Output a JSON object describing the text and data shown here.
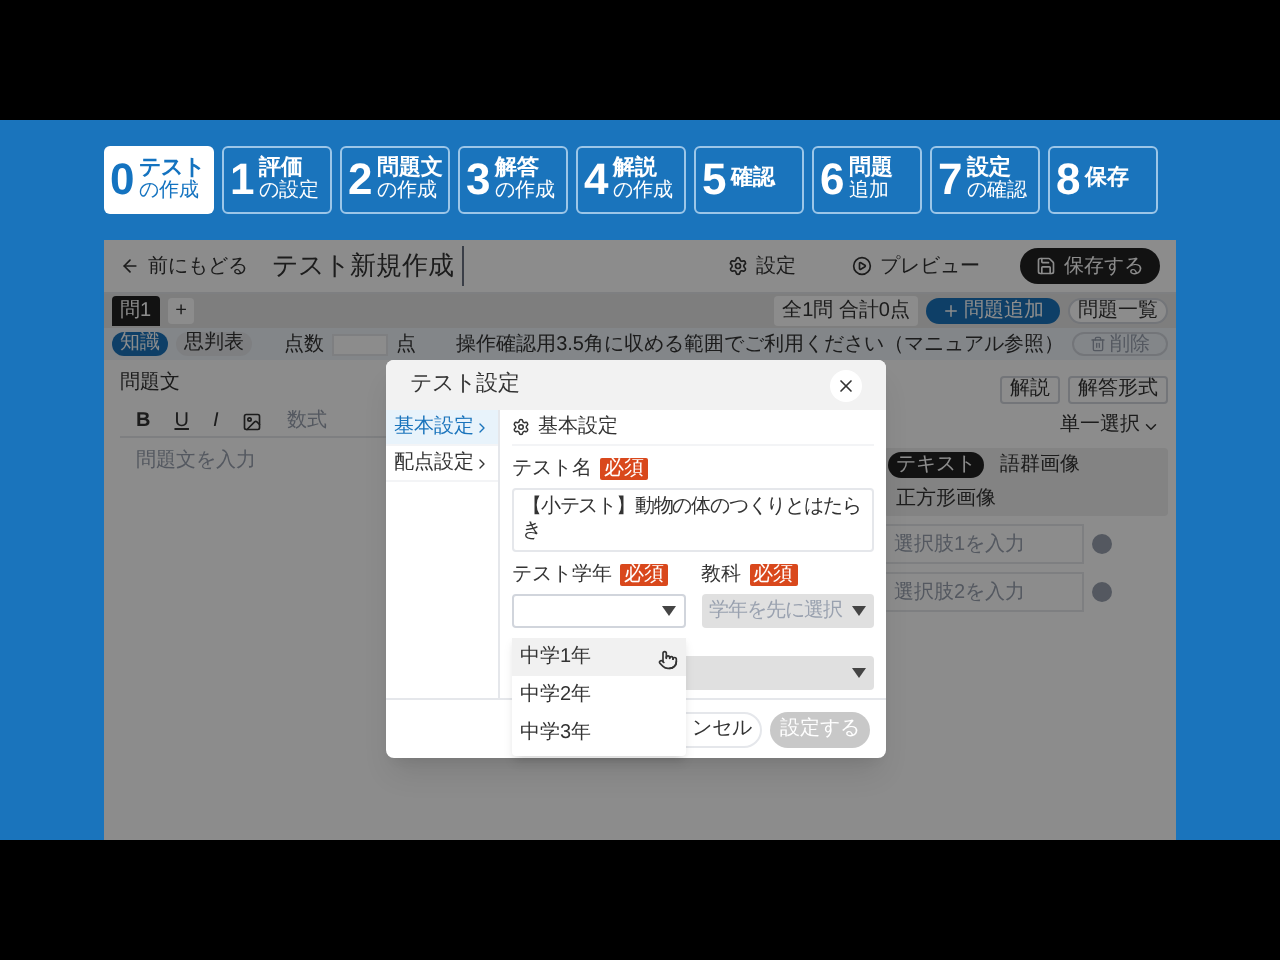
{
  "steps": [
    {
      "number": "0",
      "lines": [
        "テスト",
        "の作成"
      ],
      "selected": true
    },
    {
      "number": "1",
      "lines": [
        "評価",
        "の設定"
      ],
      "selected": false
    },
    {
      "number": "2",
      "lines": [
        "問題文",
        "の作成"
      ],
      "selected": false
    },
    {
      "number": "3",
      "lines": [
        "解答",
        "の作成"
      ],
      "selected": false
    },
    {
      "number": "4",
      "lines": [
        "解説",
        "の作成"
      ],
      "selected": false
    },
    {
      "number": "5",
      "lines": [
        "確認"
      ],
      "selected": false
    },
    {
      "number": "6",
      "lines": [
        "問題",
        "追加"
      ],
      "selected": false
    },
    {
      "number": "7",
      "lines": [
        "設定",
        "の確認"
      ],
      "selected": false
    },
    {
      "number": "8",
      "lines": [
        "保存"
      ],
      "selected": false
    }
  ],
  "app": {
    "back": "前にもどる",
    "title": "テスト新規作成",
    "actions": [
      {
        "kind": "settings",
        "label": "設定"
      },
      {
        "kind": "preview",
        "label": "プレビュー"
      },
      {
        "kind": "save",
        "label": "保存する"
      }
    ],
    "question_tabs": [
      {
        "label": "問1",
        "selected": true
      }
    ],
    "add_tab": "+",
    "summary": "全1問 合計0点",
    "add_question": "問題追加",
    "question_list": "問題一覧",
    "categories": [
      {
        "label": "知識",
        "selected": true
      },
      {
        "label": "思判表",
        "selected": false
      }
    ],
    "score_label": "点数",
    "score_unit": "点",
    "notice": "操作確認用3.5角に収める範囲でご利用ください（マニュアル参照）",
    "delete": "削除",
    "question_label": "問題文",
    "format_buttons": [
      "B",
      "U",
      "I"
    ],
    "formula": "数式",
    "question_placeholder": "問題文を入力",
    "answer_panel": {
      "buttons": [
        "解説",
        "解答形式"
      ],
      "answer_type": "単一選択",
      "tabs": [
        {
          "label": "テキスト",
          "selected": true
        },
        {
          "label": "語群画像",
          "selected": false
        },
        {
          "label": "正方形画像",
          "selected": false
        }
      ],
      "choices": [
        {
          "placeholder": "選択肢1を入力"
        },
        {
          "placeholder": "選択肢2を入力"
        }
      ]
    }
  },
  "modal": {
    "title": "テスト設定",
    "nav": [
      {
        "label": "基本設定",
        "selected": true
      },
      {
        "label": "配点設定",
        "selected": false
      }
    ],
    "section": "基本設定",
    "name_required": "必須",
    "grade_required": "必須",
    "subject_required": "必須",
    "name_label": "テスト名",
    "name_value": "【小テスト】動物の体のつくりとはたらき",
    "grade_label": "テスト学年",
    "subject_label": "教科",
    "subject_placeholder": "学年を先に選択",
    "subject_disabled": true,
    "third_disabled": true,
    "grade_options": [
      {
        "label": "中学1年",
        "hovered": true
      },
      {
        "label": "中学2年",
        "hovered": false
      },
      {
        "label": "中学3年",
        "hovered": false
      }
    ],
    "cancel": "ンセル",
    "submit": "設定する",
    "submit_disabled": true
  }
}
